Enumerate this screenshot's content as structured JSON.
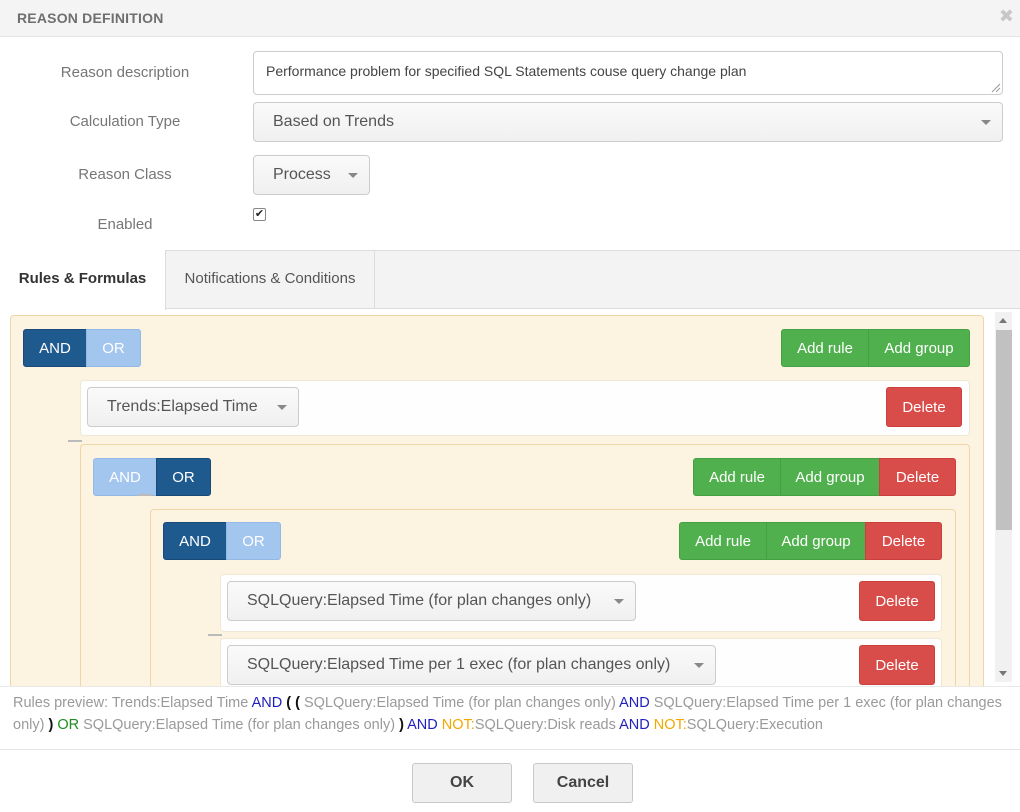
{
  "dialog": {
    "title": "REASON DEFINITION",
    "close_label": "✖"
  },
  "form": {
    "description_label": "Reason description",
    "description_value": "Performance problem for specified SQL Statements couse query change plan",
    "calculation_type_label": "Calculation Type",
    "calculation_type_value": "Based on Trends",
    "reason_class_label": "Reason Class",
    "reason_class_value": "Process",
    "enabled_label": "Enabled",
    "enabled_checked": true
  },
  "tabs": [
    {
      "label": "Rules & Formulas",
      "active": true
    },
    {
      "label": "Notifications & Conditions",
      "active": false
    }
  ],
  "builder": {
    "root": {
      "and_label": "AND",
      "or_label": "OR",
      "active": "AND",
      "add_rule_label": "Add rule",
      "add_group_label": "Add group",
      "rule1": {
        "value": "Trends:Elapsed Time",
        "delete_label": "Delete"
      },
      "group": {
        "and_label": "AND",
        "or_label": "OR",
        "active": "OR",
        "add_rule_label": "Add rule",
        "add_group_label": "Add group",
        "delete_label": "Delete",
        "inner_group": {
          "and_label": "AND",
          "or_label": "OR",
          "active": "AND",
          "add_rule_label": "Add rule",
          "add_group_label": "Add group",
          "delete_label": "Delete",
          "rules": [
            {
              "value": "SQLQuery:Elapsed Time (for plan changes only)",
              "delete_label": "Delete"
            },
            {
              "value": "SQLQuery:Elapsed Time per 1 exec (for plan changes only)",
              "delete_label": "Delete"
            }
          ]
        }
      }
    }
  },
  "preview": {
    "prefix": "Rules preview: ",
    "t1": "Trends:Elapsed Time ",
    "and1": "AND",
    "paren_open": " ( ( ",
    "t2": "SQLQuery:Elapsed Time (for plan changes only) ",
    "and2": "AND",
    "t3": " SQLQuery:Elapsed Time per 1 exec (for plan changes only) ",
    "paren_close1": ")",
    "or1": " OR",
    "t4": " SQLQuery:Elapsed Time (for plan changes only) ",
    "paren_close2": ")",
    "and3": " AND ",
    "not1": "NOT:",
    "t5": "SQLQuery:Disk reads ",
    "and4": "AND",
    "not2": " NOT:",
    "t6": "SQLQuery:Execution"
  },
  "footer": {
    "ok_label": "OK",
    "cancel_label": "Cancel"
  },
  "colors": {
    "header_bg": "#f4f4f4",
    "group_bg": "#fcf3e1",
    "toggle_active": "#1f5a8f",
    "toggle_inactive": "#a3c6ee",
    "add_green": "#50b04d",
    "delete_red": "#d84c4a",
    "and_keyword": "#1f1fbf",
    "or_keyword": "#1e8c1e",
    "not_keyword": "#f0a800"
  }
}
